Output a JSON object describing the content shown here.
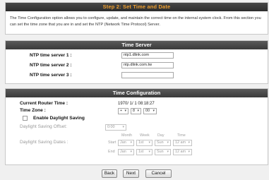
{
  "step_title": "Step 2: Set Time and Date",
  "intro_text": "The Time Configuration option allows you to configure, update, and maintain the correct time on the internal system clock. From this section you can set the time zone that you are in and set the NTP (Network Time Protocol) Server.",
  "time_server": {
    "title": "Time Server",
    "server1_label": "NTP time server 1 :",
    "server1_value": "ntp1.dlink.com",
    "server2_label": "NTP time server 2 :",
    "server2_value": "ntp.dlink.com.tw",
    "server3_label": "NTP time server 3 :",
    "server3_value": ""
  },
  "time_config": {
    "title": "Time Configuration",
    "router_time_label": "Current Router Time :",
    "router_time_value": "1970/ 1/ 1 08:18:27",
    "time_zone_label": "Time Zone :",
    "tz_sign": "+",
    "tz_hour": "8",
    "tz_min": "00",
    "enable_dst_label": "Enable Daylight Saving",
    "enable_dst_checked": false,
    "dst_offset_label": "Daylight Saving Offset:",
    "dst_offset_value": "0:00",
    "dst_dates_label": "Daylight Saving Dates :",
    "col_month": "Month",
    "col_week": "Week",
    "col_day": "Day",
    "col_time": "Time",
    "start_label": "Start",
    "start_month": "Jan",
    "start_week": "1st",
    "start_day": "Sun",
    "start_time": "12 am",
    "end_label": "End",
    "end_month": "Jan",
    "end_week": "1st",
    "end_day": "Sun",
    "end_time": "12 am"
  },
  "buttons": {
    "back": "Back",
    "next": "Next",
    "cancel": "Cancel"
  },
  "icons": {
    "dropdown_arrow": "chevron-down-icon"
  },
  "colors": {
    "step_title": "#f0a030",
    "header_bg": "#3a3a3a",
    "page_bg": "#f0f0f0"
  }
}
